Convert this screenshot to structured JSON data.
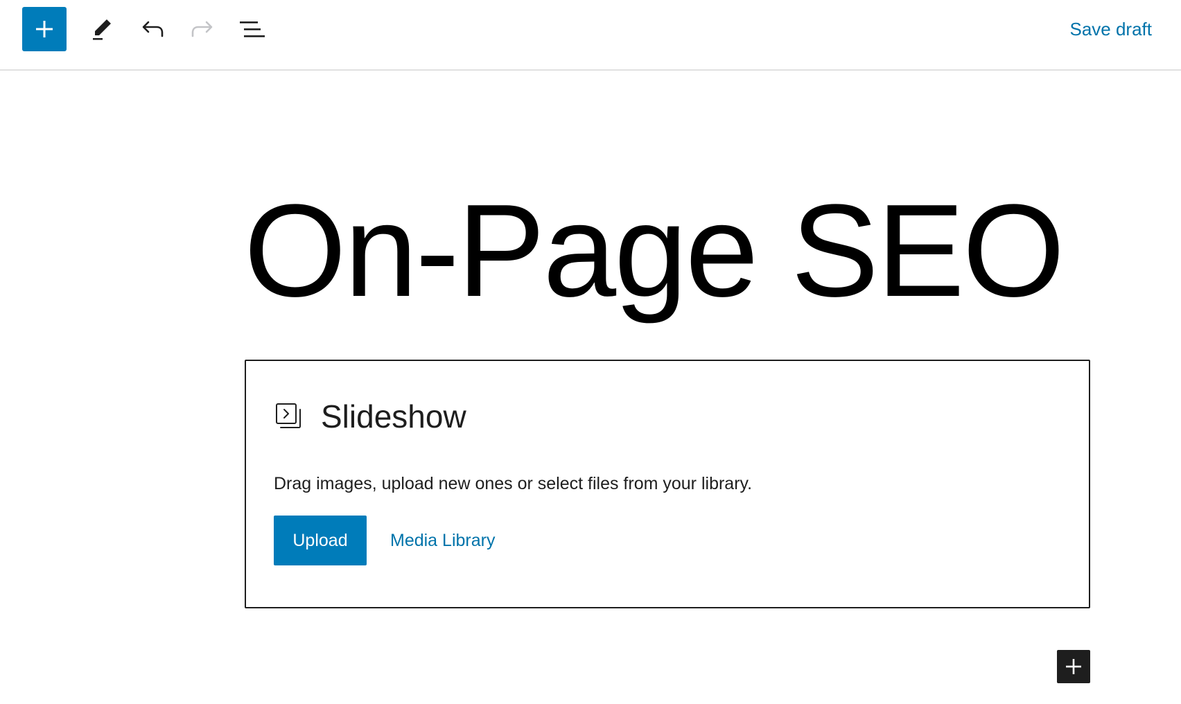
{
  "toolbar": {
    "inserter_icon": "plus-icon",
    "tools_icon": "pencil-icon",
    "undo_icon": "undo-icon",
    "redo_icon": "redo-icon",
    "list_view_icon": "list-view-icon",
    "save_draft_label": "Save draft"
  },
  "post": {
    "title": "On-Page SEO"
  },
  "slideshow_block": {
    "icon": "slideshow-icon",
    "title": "Slideshow",
    "instructions": "Drag images, upload new ones or select files from your library.",
    "upload_label": "Upload",
    "media_library_label": "Media Library"
  },
  "block_appender": {
    "icon": "plus-icon"
  },
  "colors": {
    "accent": "#007cba",
    "link": "#0073aa",
    "dark": "#1e1e1e",
    "redo_disabled": "#c3c4c7"
  }
}
